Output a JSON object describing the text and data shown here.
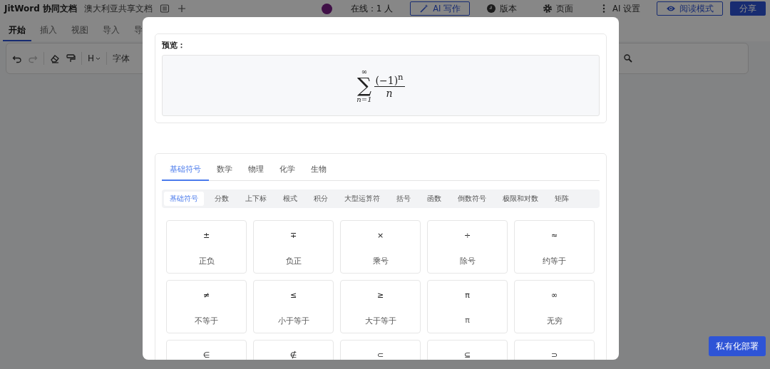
{
  "header": {
    "app_title": "JitWord 协同文档",
    "doc_title": "澳大利亚共享文档",
    "online": "在线：1 人",
    "actions": [
      {
        "kind": "outline",
        "label": "AI 写作"
      },
      {
        "kind": "plain",
        "label": "版本"
      },
      {
        "kind": "plain",
        "label": "页面"
      },
      {
        "kind": "plain",
        "label": "AI 设置"
      },
      {
        "kind": "outline",
        "label": "阅读模式"
      },
      {
        "kind": "primary",
        "label": "分享"
      }
    ]
  },
  "menu_tabs": [
    {
      "label": "开始",
      "selected": true
    },
    {
      "label": "插入",
      "selected": false
    },
    {
      "label": "视图",
      "selected": false
    },
    {
      "label": "导入",
      "selected": false
    },
    {
      "label": "导",
      "selected": false
    }
  ],
  "toolbar": {
    "items": [
      {
        "kind": "undo",
        "disabled": false
      },
      {
        "kind": "redo",
        "disabled": true
      },
      {
        "kind": "eraser",
        "disabled": false
      },
      {
        "kind": "painter",
        "disabled": false
      },
      {
        "kind": "heading",
        "label": "H",
        "disabled": false
      },
      {
        "kind": "text",
        "label": "字体",
        "disabled": false
      }
    ]
  },
  "deploy_button": "私有化部署",
  "dialog": {
    "preview_label": "预览：",
    "formula": {
      "operator": "∑",
      "upper": "∞",
      "lower": "n=1",
      "numerator": "(−1)$^{n}$",
      "denominator": "n"
    },
    "subject_tabs": [
      {
        "label": "基础符号",
        "selected": true
      },
      {
        "label": "数学",
        "selected": false
      },
      {
        "label": "物理",
        "selected": false
      },
      {
        "label": "化学",
        "selected": false
      },
      {
        "label": "生物",
        "selected": false
      }
    ],
    "categories": [
      {
        "label": "基础符号",
        "selected": true
      },
      {
        "label": "分数",
        "selected": false
      },
      {
        "label": "上下标",
        "selected": false
      },
      {
        "label": "根式",
        "selected": false
      },
      {
        "label": "积分",
        "selected": false
      },
      {
        "label": "大型运算符",
        "selected": false
      },
      {
        "label": "括号",
        "selected": false
      },
      {
        "label": "函数",
        "selected": false
      },
      {
        "label": "倒数符号",
        "selected": false
      },
      {
        "label": "极限和对数",
        "selected": false
      },
      {
        "label": "矩阵",
        "selected": false
      }
    ],
    "symbols": [
      {
        "symbol": "±",
        "label": "正负"
      },
      {
        "symbol": "∓",
        "label": "负正"
      },
      {
        "symbol": "×",
        "label": "乘号"
      },
      {
        "symbol": "÷",
        "label": "除号"
      },
      {
        "symbol": "≈",
        "label": "约等于"
      },
      {
        "symbol": "≠",
        "label": "不等于"
      },
      {
        "symbol": "≤",
        "label": "小于等于"
      },
      {
        "symbol": "≥",
        "label": "大于等于"
      },
      {
        "symbol": "π",
        "label": "π"
      },
      {
        "symbol": "∞",
        "label": "无穷"
      },
      {
        "symbol": "∈"
      },
      {
        "symbol": "∉"
      },
      {
        "symbol": "⊂"
      },
      {
        "symbol": "⊆"
      },
      {
        "symbol": "⊃"
      }
    ]
  }
}
